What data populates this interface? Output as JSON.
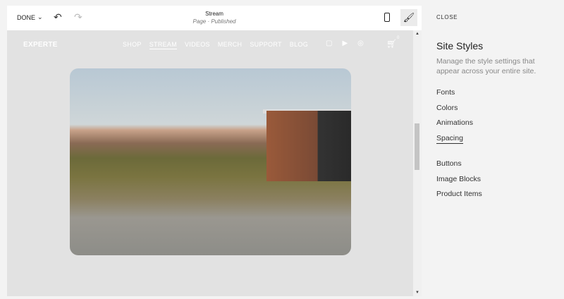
{
  "toolbar": {
    "done_label": "DONE",
    "page_title": "Stream",
    "page_status": "Page · Published"
  },
  "site": {
    "logo": "EXPERTE",
    "nav": [
      "SHOP",
      "STREAM",
      "VIDEOS",
      "MERCH",
      "SUPPORT",
      "BLOG"
    ],
    "active_nav": "STREAM",
    "cart_count": "0"
  },
  "panel": {
    "close_label": "CLOSE",
    "title": "Site Styles",
    "description": "Manage the style settings that appear across your entire site.",
    "items": [
      "Fonts",
      "Colors",
      "Animations",
      "Spacing",
      "Buttons",
      "Image Blocks",
      "Product Items"
    ],
    "selected": "Spacing"
  }
}
